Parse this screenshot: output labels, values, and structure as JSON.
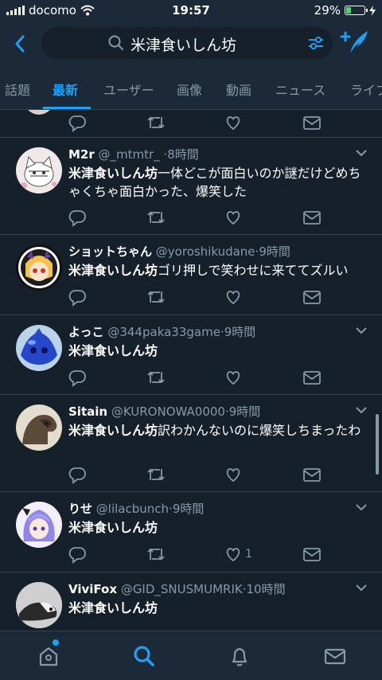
{
  "status_bar": {
    "carrier": "docomo",
    "time": "19:57",
    "battery": "29%",
    "battery_level": 0.29
  },
  "search": {
    "query": "米津食いしん坊"
  },
  "tabs": [
    {
      "label": "話題"
    },
    {
      "label": "最新"
    },
    {
      "label": "ユーザー"
    },
    {
      "label": "画像"
    },
    {
      "label": "動画"
    },
    {
      "label": "ニュース"
    },
    {
      "label": "ライブ"
    }
  ],
  "active_tab": "最新",
  "tweets": [
    {
      "name": "M2r",
      "handle": "@_mtmtr_",
      "time": "8時間",
      "text_bold": "米津食いしん坊",
      "text_rest": "一体どこが面白いのか謎だけどめちゃくちゃ面白かった、爆笑した",
      "likes": ""
    },
    {
      "name": "ショットちゃん",
      "handle": "@yoroshikudane",
      "time": "9時間",
      "text_bold": "米津食いしん坊",
      "text_rest": "ゴリ押しで笑わせに来ててズルい",
      "likes": ""
    },
    {
      "name": "よっこ",
      "handle": "@344paka33game",
      "time": "9時間",
      "text_bold": "米津食いしん坊",
      "text_rest": "",
      "likes": ""
    },
    {
      "name": "Sitain",
      "handle": "@KURONOWA0000",
      "time": "9時間",
      "text_bold": "米津食いしん坊",
      "text_rest": "訳わかんないのに爆笑しちまったわ",
      "likes": ""
    },
    {
      "name": "りせ",
      "handle": "@lilacbunch",
      "time": "9時間",
      "text_bold": "米津食いしん坊",
      "text_rest": "",
      "likes": "1"
    },
    {
      "name": "ViviFox",
      "handle": "@GID_SNUSMUMRIK",
      "time": "10時間",
      "text_bold": "米津食いしん坊",
      "text_rest": "",
      "likes": ""
    }
  ],
  "colors": {
    "background": "#15202b",
    "bar": "#1c2938",
    "accent": "#1da1f2",
    "muted": "#8899a6",
    "divider": "#38444d",
    "battery": "#4cd964"
  },
  "icons": {
    "back": "chevron-left-icon",
    "search": "search-icon",
    "filter": "filter-sliders-icon",
    "compose": "compose-feather-icon",
    "reply": "reply-icon",
    "retweet": "retweet-icon",
    "like": "heart-icon",
    "dm": "envelope-icon",
    "caret": "chevron-down-icon",
    "home": "home-icon",
    "notifications": "bell-icon",
    "messages": "envelope-icon"
  }
}
